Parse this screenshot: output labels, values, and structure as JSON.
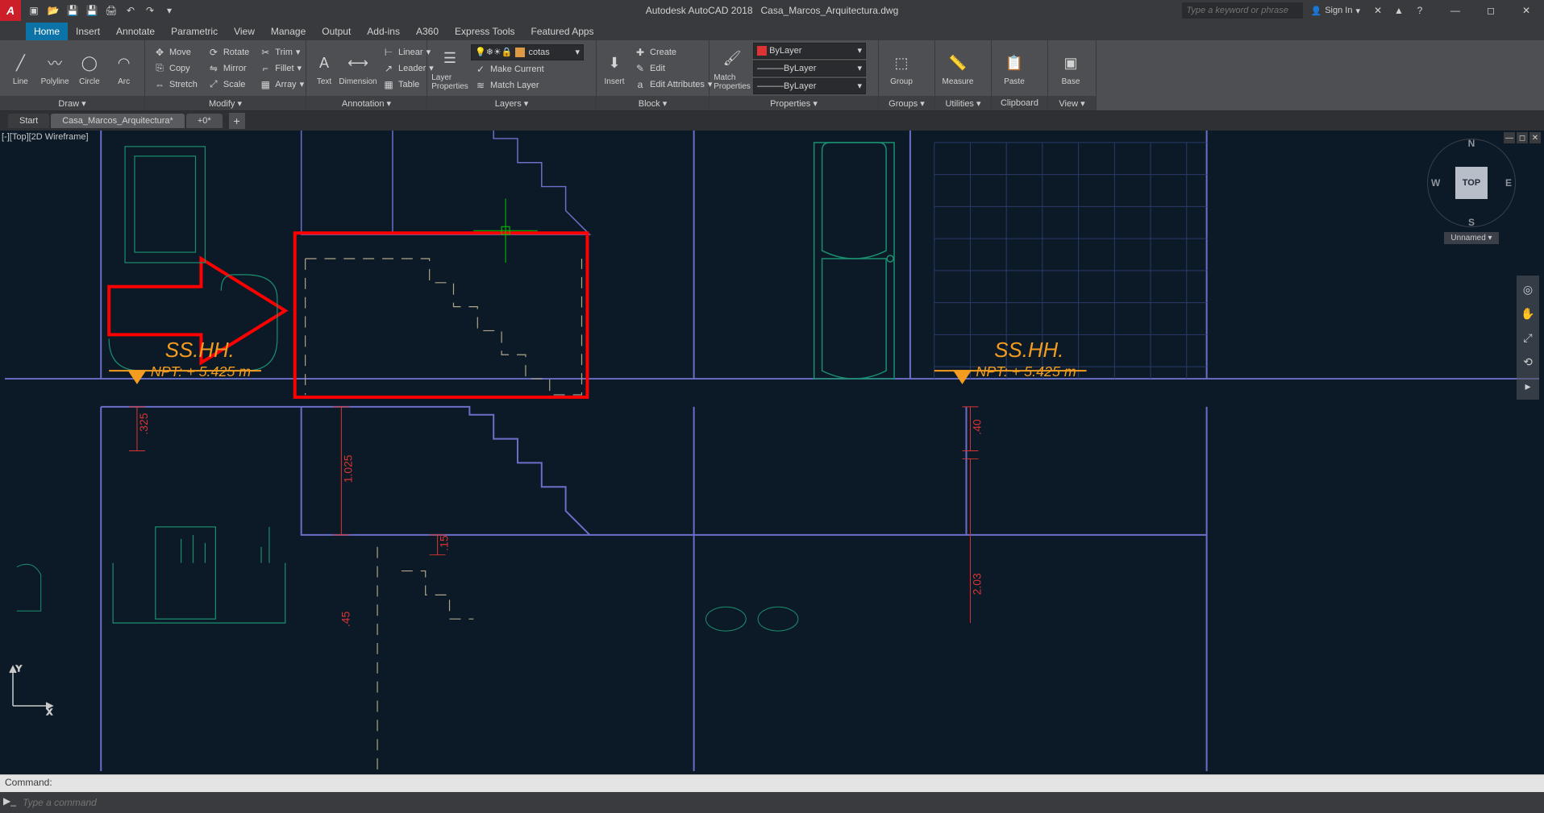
{
  "app": {
    "name": "Autodesk AutoCAD 2018",
    "document": "Casa_Marcos_Arquitectura.dwg",
    "search_placeholder": "Type a keyword or phrase",
    "signin": "Sign In"
  },
  "ribbon_tabs": [
    "Home",
    "Insert",
    "Annotate",
    "Parametric",
    "View",
    "Manage",
    "Output",
    "Add-ins",
    "A360",
    "Express Tools",
    "Featured Apps"
  ],
  "active_ribbon_tab": "Home",
  "panels": {
    "draw": {
      "title": "Draw ▾",
      "items": [
        "Line",
        "Polyline",
        "Circle",
        "Arc"
      ]
    },
    "modify": {
      "title": "Modify ▾",
      "items": [
        "Move",
        "Rotate",
        "Trim",
        "Copy",
        "Mirror",
        "Fillet",
        "Stretch",
        "Scale",
        "Array"
      ]
    },
    "annotation": {
      "title": "Annotation ▾",
      "text": "Text",
      "dim": "Dimension",
      "linear": "Linear",
      "leader": "Leader",
      "table": "Table"
    },
    "layers": {
      "title": "Layers ▾",
      "layer_prop": "Layer\nProperties",
      "current": "cotas",
      "make_current": "Make Current",
      "match_layer": "Match Layer"
    },
    "block": {
      "title": "Block ▾",
      "insert": "Insert",
      "create": "Create",
      "edit": "Edit",
      "edit_attr": "Edit Attributes"
    },
    "properties": {
      "title": "Properties ▾",
      "match": "Match\nProperties",
      "bylayer": "ByLayer"
    },
    "groups": {
      "title": "Groups ▾",
      "group": "Group"
    },
    "utilities": {
      "title": "Utilities ▾",
      "measure": "Measure"
    },
    "clipboard": {
      "title": "Clipboard",
      "paste": "Paste"
    },
    "view": {
      "title": "View ▾",
      "base": "Base"
    }
  },
  "file_tabs": {
    "start": "Start",
    "active": "Casa_Marcos_Arquitectura*",
    "other": "+0*"
  },
  "viewport": {
    "label": "[-][Top][2D Wireframe]"
  },
  "viewcube": {
    "face": "TOP",
    "wcs": "Unnamed",
    "n": "N",
    "s": "S",
    "e": "E",
    "w": "W"
  },
  "drawing_labels": {
    "sshh1": "SS.HH.",
    "npt1": "NPT: + 5.425 m",
    "sshh2": "SS.HH.",
    "npt2": "NPT: + 5.425 m",
    "dim_325": ".325",
    "dim_1025": "1.025",
    "dim_15": ".15",
    "dim_40": ".40",
    "dim_203": "2.03",
    "dim_45": ".45"
  },
  "command": {
    "history": "Command:",
    "placeholder": "Type a command"
  }
}
